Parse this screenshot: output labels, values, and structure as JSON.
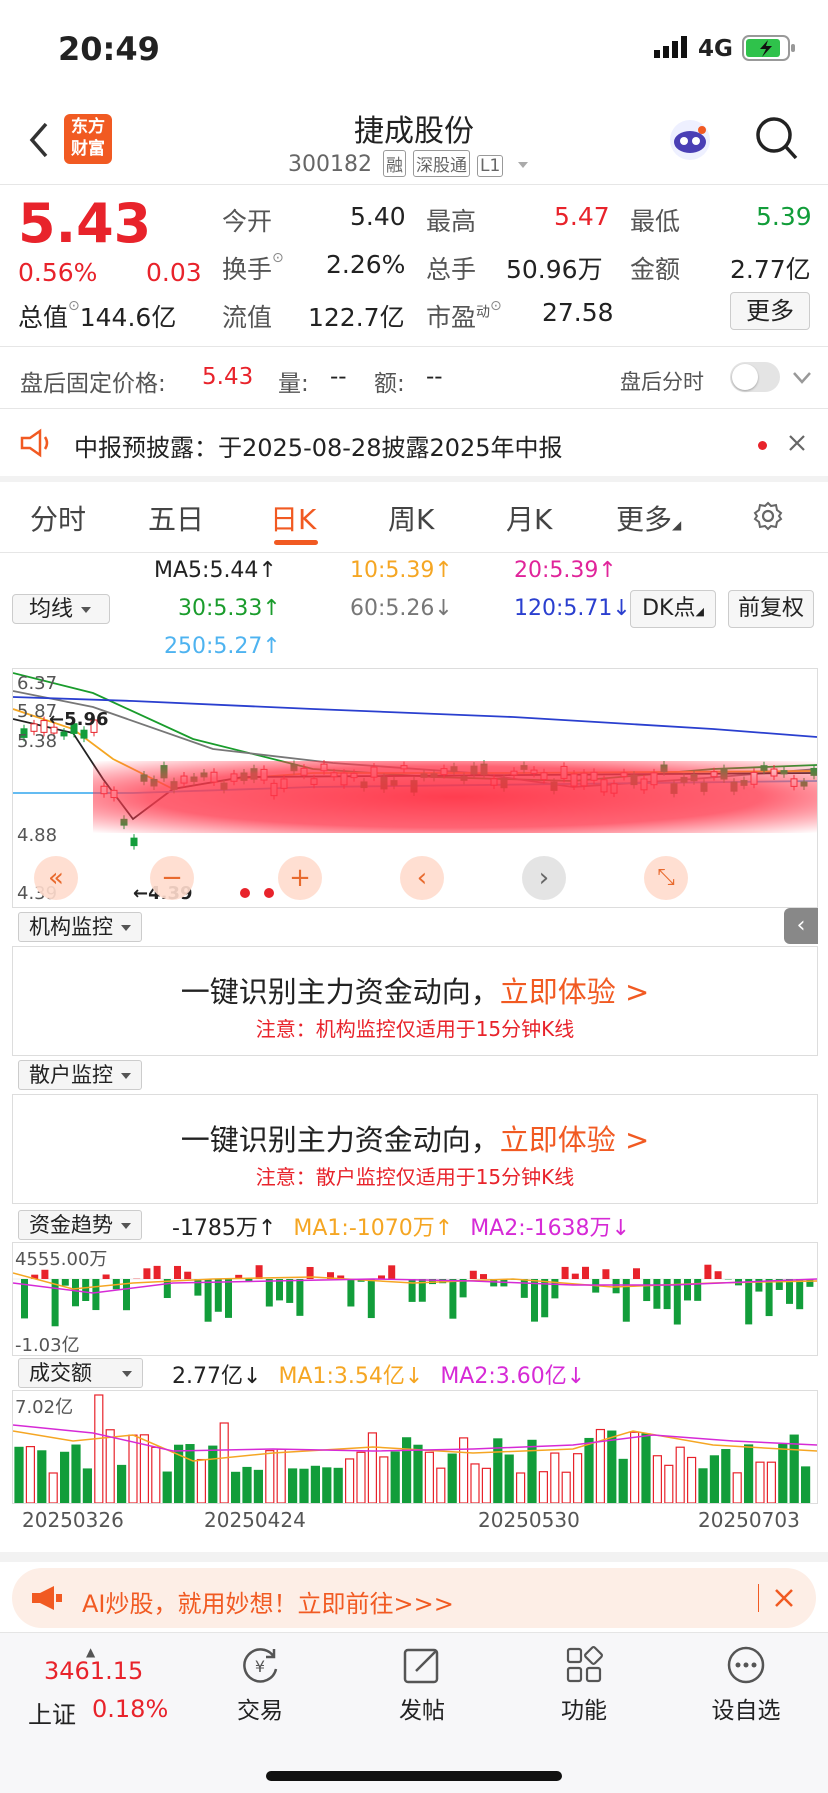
{
  "status_bar": {
    "time": "20:49",
    "network": "4G"
  },
  "header": {
    "logo_line1": "东方",
    "logo_line2": "财富",
    "title": "捷成股份",
    "code": "300182",
    "badges": [
      "融",
      "深股通",
      "L1"
    ]
  },
  "quote": {
    "price": "5.43",
    "change_pct": "0.56%",
    "change": "0.03",
    "rows": [
      [
        {
          "label": "今开",
          "value": "5.40"
        },
        {
          "label": "最高",
          "value": "5.47"
        },
        {
          "label": "最低",
          "value": "5.39"
        }
      ],
      [
        {
          "label": "换手",
          "value": "2.26%"
        },
        {
          "label": "总手",
          "value": "50.96万"
        },
        {
          "label": "金额",
          "value": "2.77亿"
        }
      ],
      [
        {
          "label": "总值",
          "value": "144.6亿"
        },
        {
          "label": "流值",
          "value": "122.7亿"
        },
        {
          "label": "市盈",
          "sup": "动",
          "value": "27.58"
        }
      ]
    ],
    "more_label": "更多"
  },
  "after_hours": {
    "label": "盘后固定价格:",
    "price": "5.43",
    "vol_label": "量:",
    "vol": "--",
    "amt_label": "额:",
    "amt": "--",
    "toggle_label": "盘后分时"
  },
  "notice": {
    "text": "中报预披露：于2025-08-28披露2025年中报"
  },
  "tabs": [
    "分时",
    "五日",
    "日K",
    "周K",
    "月K",
    "更多"
  ],
  "active_tab": "日K",
  "ma": {
    "selector": "均线",
    "ma5": "MA5:5.44",
    "ma10": "10:5.39",
    "ma20": "20:5.39",
    "ma30": "30:5.33",
    "ma60": "60:5.26",
    "ma120": "120:5.71",
    "ma250": "250:5.27",
    "dk_label": "DK点",
    "fq_label": "前复权",
    "colors": {
      "ma5": "#222222",
      "ma10": "#f5a623",
      "ma20": "#e0249a",
      "ma30": "#1a9c2c",
      "ma60": "#777777",
      "ma120": "#2a3fcf",
      "ma250": "#4eb3f0"
    }
  },
  "kline": {
    "y_labels": [
      "6.37",
      "5.87",
      "5.38",
      "4.88",
      "4.39"
    ],
    "high_label": "5.96",
    "low_label": "4.39"
  },
  "institution": {
    "selector": "机构监控",
    "headline": "一键识别主力资金动向，",
    "cta": "立即体验 >",
    "note": "注意：机构监控仅适用于15分钟K线"
  },
  "retail": {
    "selector": "散户监控",
    "headline": "一键识别主力资金动向，",
    "cta": "立即体验 >",
    "note": "注意：散户监控仅适用于15分钟K线"
  },
  "fund_flow": {
    "selector": "资金趋势",
    "value": "-1785万",
    "ma1": "MA1:-1070万",
    "ma2": "MA2:-1638万",
    "y_top": "4555.00万",
    "y_bottom": "-1.03亿"
  },
  "turnover": {
    "selector": "成交额",
    "value": "2.77亿",
    "ma1": "MA1:3.54亿",
    "ma2": "MA2:3.60亿",
    "y_top": "7.02亿",
    "dates": [
      "20250326",
      "20250424",
      "20250530",
      "20250703"
    ]
  },
  "promo": {
    "text": "AI炒股，就用妙想！立即前往>>>"
  },
  "bottom_nav": {
    "index_value": "3461.15",
    "index_name": "上证",
    "index_change": "0.18%",
    "items": [
      {
        "label": "交易",
        "icon": "yen-cycle-icon"
      },
      {
        "label": "发帖",
        "icon": "edit-icon"
      },
      {
        "label": "功能",
        "icon": "grid-icon"
      },
      {
        "label": "设自选",
        "icon": "more-dots-icon"
      }
    ]
  }
}
